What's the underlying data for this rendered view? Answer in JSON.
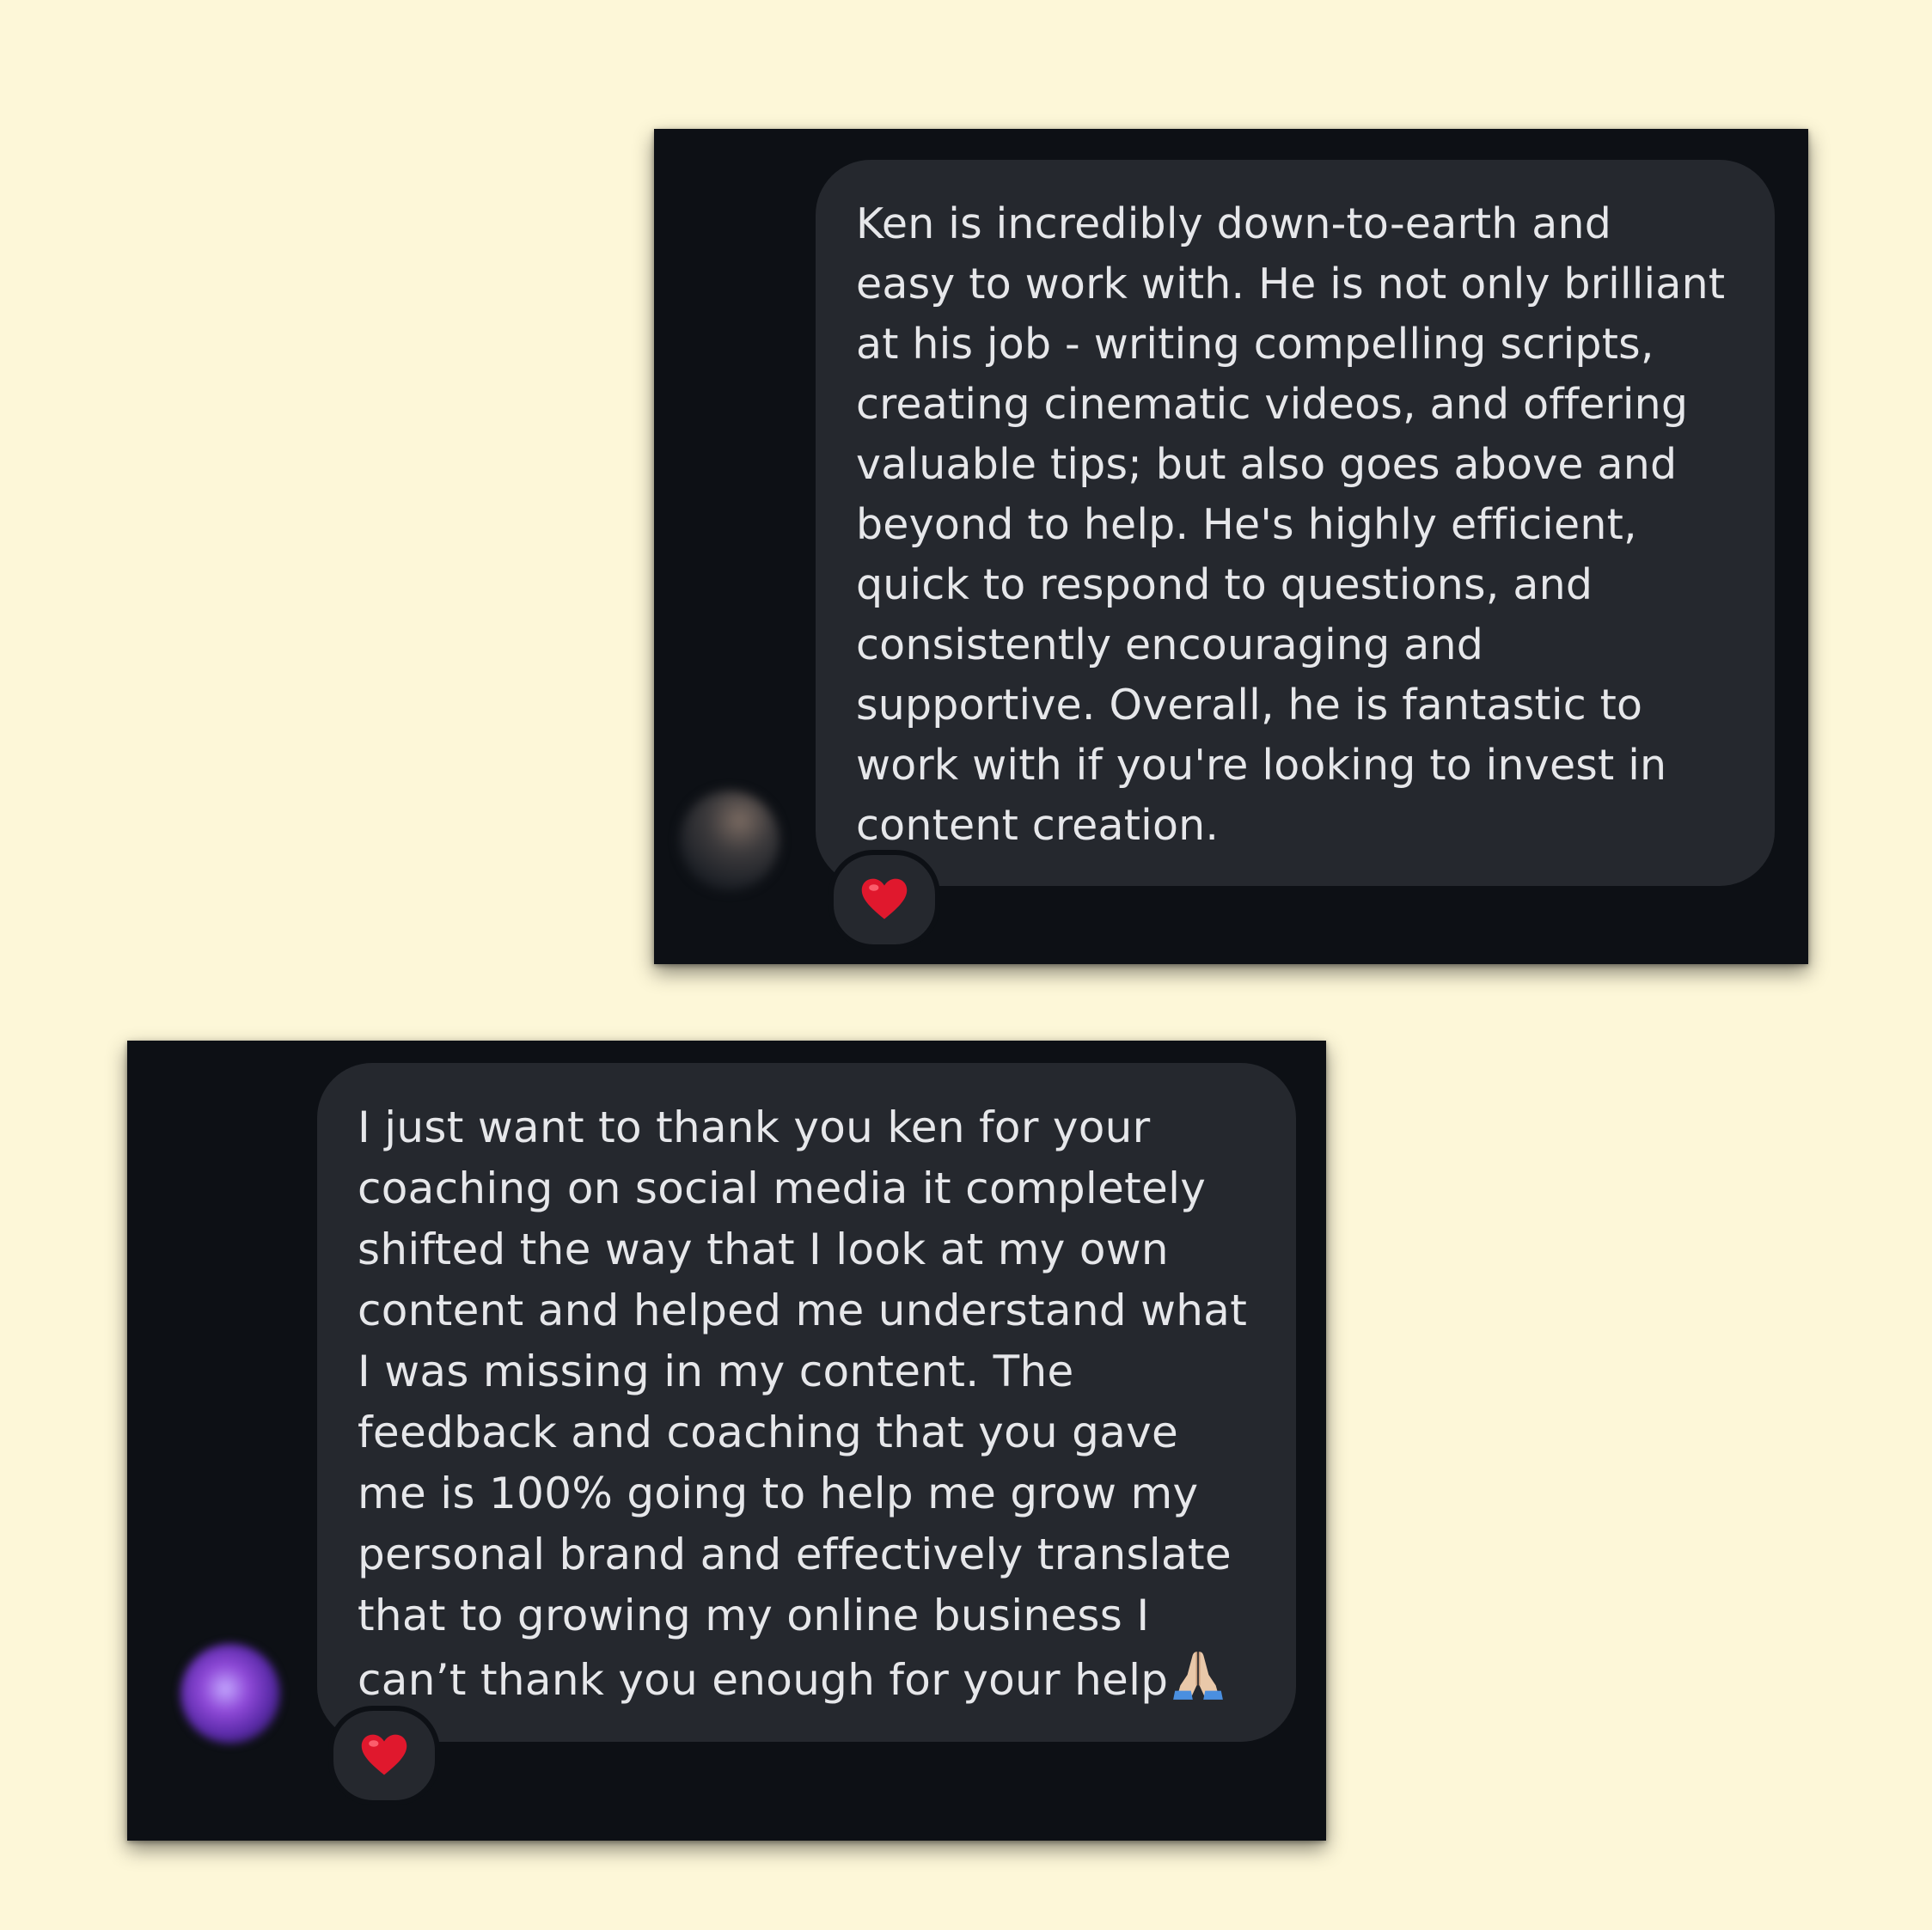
{
  "colors": {
    "page_background": "#fdf7d8",
    "card_background": "#0d1015",
    "bubble_background": "#25282e",
    "message_text": "#e6e7ea",
    "heart": "#e0182d"
  },
  "messages": [
    {
      "lines": [
        "Ken is incredibly down-to-earth and",
        "easy to work with. He is not only brilliant",
        "at his job - writing compelling scripts,",
        "creating cinematic videos, and offering",
        "valuable tips; but also goes above and",
        "beyond to help. He's highly efficient,",
        "quick to respond to questions, and",
        "consistently encouraging and",
        "supportive. Overall, he is fantastic to",
        "work with if you're looking to invest in",
        "content creation."
      ],
      "reaction_icon": "red-heart-icon",
      "avatar_icon": "blurred-profile-photo"
    },
    {
      "lines": [
        "I just want to thank you ken for your",
        "coaching on social media it completely",
        "shifted the way that I look at my own",
        "content and helped me understand what",
        "I was missing in my content. The",
        "feedback and coaching that you gave",
        "me is 100% going to help me grow my",
        "personal brand and effectively translate",
        "that to growing my online business I",
        "can’t thank you enough for your help"
      ],
      "trailing_emoji": "folded-hands-icon",
      "reaction_icon": "red-heart-icon",
      "avatar_icon": "blurred-purple-profile-photo"
    }
  ]
}
